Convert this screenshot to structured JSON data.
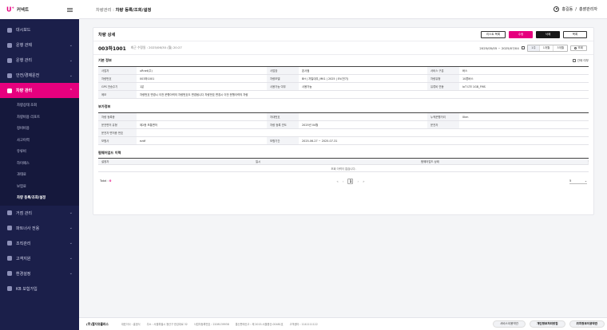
{
  "brand": {
    "mark": "U",
    "plus": "+",
    "name": "커넥트"
  },
  "sidebar": {
    "items": [
      {
        "label": "대시보드",
        "has_children": false
      },
      {
        "label": "운행 관제",
        "has_children": true
      },
      {
        "label": "운행 관리",
        "has_children": true
      },
      {
        "label": "안전/경제운전",
        "has_children": true
      },
      {
        "label": "차량 관리",
        "has_children": true,
        "active": true,
        "children": [
          {
            "label": "차량상태 조회"
          },
          {
            "label": "차량비용 리포트"
          },
          {
            "label": "정비비용"
          },
          {
            "label": "사고이력"
          },
          {
            "label": "유류비"
          },
          {
            "label": "하이패스"
          },
          {
            "label": "과태료"
          },
          {
            "label": "보험료"
          },
          {
            "label": "차량 등록/조회/설정",
            "active": true
          }
        ]
      },
      {
        "label": "거점 관리",
        "has_children": true
      },
      {
        "label": "파트너사 전용",
        "has_children": true
      },
      {
        "label": "조직관리",
        "has_children": true
      },
      {
        "label": "고객지원",
        "has_children": true
      },
      {
        "label": "환경설정",
        "has_children": true
      },
      {
        "label": "KB 보험가입",
        "has_children": false
      }
    ]
  },
  "topbar": {
    "crumb_parent": "차량관리 : ",
    "crumb_current": "차량 등록/조회/설정",
    "user_name": "홍길동",
    "user_sep": " / ",
    "user_role": "총괄관리자"
  },
  "card": {
    "title": "차량 상세",
    "buttons": {
      "list": "리스트 목록",
      "edit": "수정",
      "delete": "삭제",
      "back": "목록"
    },
    "vehicle_no": "003하1001",
    "last_modified": "최근 수정일 : 2025/06/30 (월) 20:27",
    "date_range": "2025/05/05 ~ 2025/07/04",
    "periods": [
      "1주",
      "1개월",
      "3개월"
    ],
    "lookup": "조회"
  },
  "basic": {
    "title": "기본 정보",
    "option_label": "관제 여부",
    "rows": [
      [
        "사업자",
        "uRnet(주)",
        "사업장",
        "본사점",
        "서비스 구분",
        "버스"
      ],
      [
        "차량번호",
        "003하1001",
        "차량모델",
        "BH | 자일대우_MK1 | 2025 | EV(전기)",
        "차량유형",
        "10톤버스"
      ],
      [
        "GPS 전송주기",
        "1분",
        "사용가능 여부",
        "사용가능",
        "유류비 연동",
        "IoT LTE 1GB_FMS"
      ]
    ],
    "note_label": "메모",
    "note_value": "차량번호 변경시 이전 운행이력의 차량번호도 변경됩니다 차량번호 변경시 이전 운행이력의 차량"
  },
  "extra": {
    "title": "부가정보",
    "rows": [
      [
        "차량 등록증",
        "",
        "차대번호",
        "",
        "누적운행거리",
        "0km"
      ],
      [
        "운전면허 유형",
        "제2종 보통면허",
        "차량 등록 연도",
        "2025년 04월",
        "운전자",
        ""
      ]
    ],
    "license_label": "운전자 면허증 번호",
    "insurance": [
      "보험사",
      "ezdf",
      "보험기간",
      "2025-06-27 ~ 2025-07-31"
    ]
  },
  "firmware": {
    "title": "펌웨어업드 이력",
    "columns": [
      "설정자",
      "일시",
      "펌웨어업드 상태"
    ],
    "empty": "조회 이력이 없습니다.",
    "total_label": "Total : ",
    "total_value": "0",
    "page": "1",
    "page_size": "5"
  },
  "footer": {
    "company": "(주)엘지유플러스",
    "info": [
      "대표이사 : 홍범식",
      "주소 : 서울특별시 용산구 한강대로 32",
      "사업자등록번호 : 2208139938",
      "통신판매신고 : 제 2015-서울용산-00481호",
      "고객센터 : 1141111122"
    ],
    "links": [
      "서비스이용약관",
      "개인정보처리방침",
      "위치정보이용약관"
    ]
  }
}
